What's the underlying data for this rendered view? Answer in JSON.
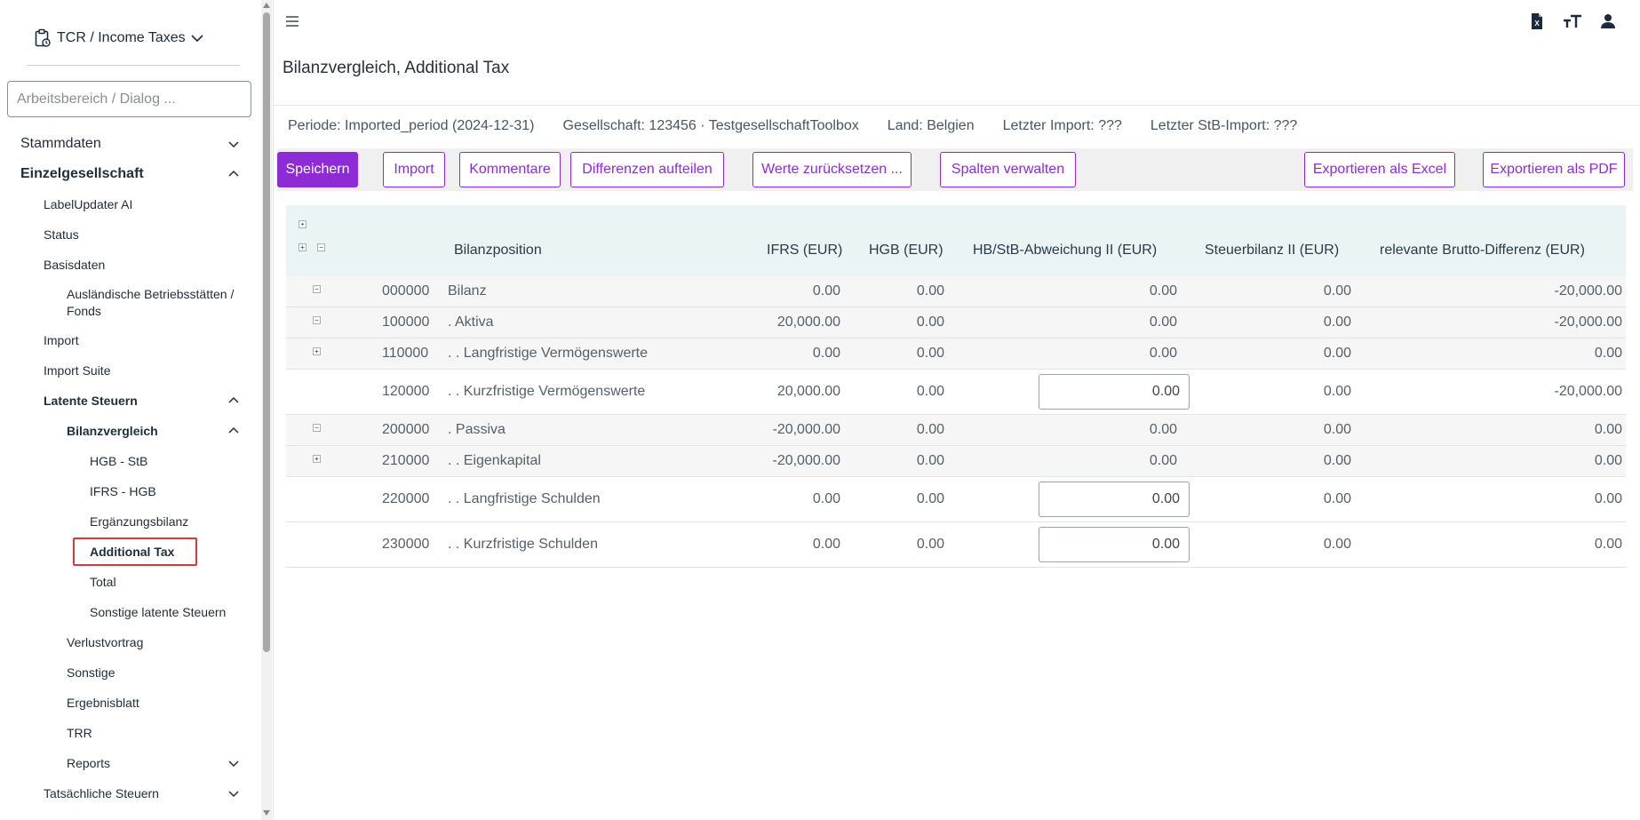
{
  "app": {
    "title": "TCR / Income Taxes"
  },
  "search": {
    "placeholder": "Arbeitsbereich / Dialog ..."
  },
  "nav": [
    {
      "label": "Stammdaten",
      "level": 0,
      "bold": false,
      "chevron": "down"
    },
    {
      "label": "Einzelgesellschaft",
      "level": 0,
      "bold": true,
      "chevron": "up"
    },
    {
      "label": "LabelUpdater AI",
      "level": 1
    },
    {
      "label": "Status",
      "level": 1
    },
    {
      "label": "Basisdaten",
      "level": 1
    },
    {
      "label": "Ausländische Betriebsstätten / Fonds",
      "level": 2,
      "tall": true
    },
    {
      "label": "Import",
      "level": 1
    },
    {
      "label": "Import Suite",
      "level": 1
    },
    {
      "label": "Latente Steuern",
      "level": 1,
      "bold": true,
      "chevron": "up"
    },
    {
      "label": "Bilanzvergleich",
      "level": 2,
      "bold": true,
      "chevron": "up"
    },
    {
      "label": "HGB - StB",
      "level": 3
    },
    {
      "label": "IFRS - HGB",
      "level": 3
    },
    {
      "label": "Ergänzungsbilanz",
      "level": 3
    },
    {
      "label": "Additional Tax",
      "level": 3,
      "bold": true,
      "selected": true
    },
    {
      "label": "Total",
      "level": 3
    },
    {
      "label": "Sonstige latente Steuern",
      "level": 3
    },
    {
      "label": "Verlustvortrag",
      "level": 2
    },
    {
      "label": "Sonstige",
      "level": 2
    },
    {
      "label": "Ergebnisblatt",
      "level": 2
    },
    {
      "label": "TRR",
      "level": 2
    },
    {
      "label": "Reports",
      "level": 2,
      "chevron": "down"
    },
    {
      "label": "Tatsächliche Steuern",
      "level": 1,
      "chevron": "down"
    }
  ],
  "page": {
    "title": "Bilanzvergleich, Additional Tax"
  },
  "info": {
    "periode": "Periode: Imported_period (2024-12-31)",
    "gesellschaft": "Gesellschaft: 123456 · TestgesellschaftToolbox",
    "land": "Land: Belgien",
    "letzter_import": "Letzter Import: ???",
    "letzter_stb_import": "Letzter StB-Import: ???"
  },
  "toolbar": {
    "save": "Speichern",
    "import": "Import",
    "comments": "Kommentare",
    "split": "Differenzen aufteilen",
    "reset": "Werte zurücksetzen ...",
    "columns": "Spalten verwalten",
    "excel": "Exportieren als Excel",
    "pdf": "Exportieren als PDF"
  },
  "table": {
    "headers": {
      "position": "Bilanzposition",
      "ifrs": "IFRS (EUR)",
      "hgb": "HGB (EUR)",
      "hbstb": "HB/StB-Abweichung II (EUR)",
      "steuerbilanz": "Steuerbilanz II (EUR)",
      "brutto": "relevante Brutto-Differenz (EUR)"
    },
    "rows": [
      {
        "toggle": "−",
        "code": "000000",
        "name": "Bilanz",
        "ifrs": "0.00",
        "hgb": "0.00",
        "hbstb": "0.00",
        "steuerbilanz": "0.00",
        "brutto": "-20,000.00"
      },
      {
        "toggle": "−",
        "code": "100000",
        "name": ". Aktiva",
        "ifrs": "20,000.00",
        "hgb": "0.00",
        "hbstb": "0.00",
        "steuerbilanz": "0.00",
        "brutto": "-20,000.00"
      },
      {
        "toggle": "+",
        "code": "110000",
        "name": ".  . Langfristige Vermögenswerte",
        "ifrs": "0.00",
        "hgb": "0.00",
        "hbstb": "0.00",
        "steuerbilanz": "0.00",
        "brutto": "0.00"
      },
      {
        "toggle": "",
        "code": "120000",
        "name": ".  . Kurzfristige Vermögenswerte",
        "ifrs": "20,000.00",
        "hgb": "0.00",
        "hbstb": "0.00",
        "editable": true,
        "steuerbilanz": "0.00",
        "brutto": "-20,000.00"
      },
      {
        "toggle": "−",
        "code": "200000",
        "name": ". Passiva",
        "ifrs": "-20,000.00",
        "hgb": "0.00",
        "hbstb": "0.00",
        "steuerbilanz": "0.00",
        "brutto": "0.00"
      },
      {
        "toggle": "+",
        "code": "210000",
        "name": ".  . Eigenkapital",
        "ifrs": "-20,000.00",
        "hgb": "0.00",
        "hbstb": "0.00",
        "steuerbilanz": "0.00",
        "brutto": "0.00"
      },
      {
        "toggle": "",
        "code": "220000",
        "name": ".  . Langfristige Schulden",
        "ifrs": "0.00",
        "hgb": "0.00",
        "hbstb": "0.00",
        "editable": true,
        "steuerbilanz": "0.00",
        "brutto": "0.00"
      },
      {
        "toggle": "",
        "code": "230000",
        "name": ".  . Kurzfristige Schulden",
        "ifrs": "0.00",
        "hgb": "0.00",
        "hbstb": "0.00",
        "editable": true,
        "steuerbilanz": "0.00",
        "brutto": "0.00"
      }
    ]
  },
  "colors": {
    "accent": "#8e2bd6",
    "header_bg": "#eaf4f5",
    "selection_outline": "#d9363e"
  },
  "icons": {
    "menu": "hamburger-icon",
    "excel": "excel-file-icon",
    "text_size": "text-size-icon",
    "user": "user-icon"
  }
}
